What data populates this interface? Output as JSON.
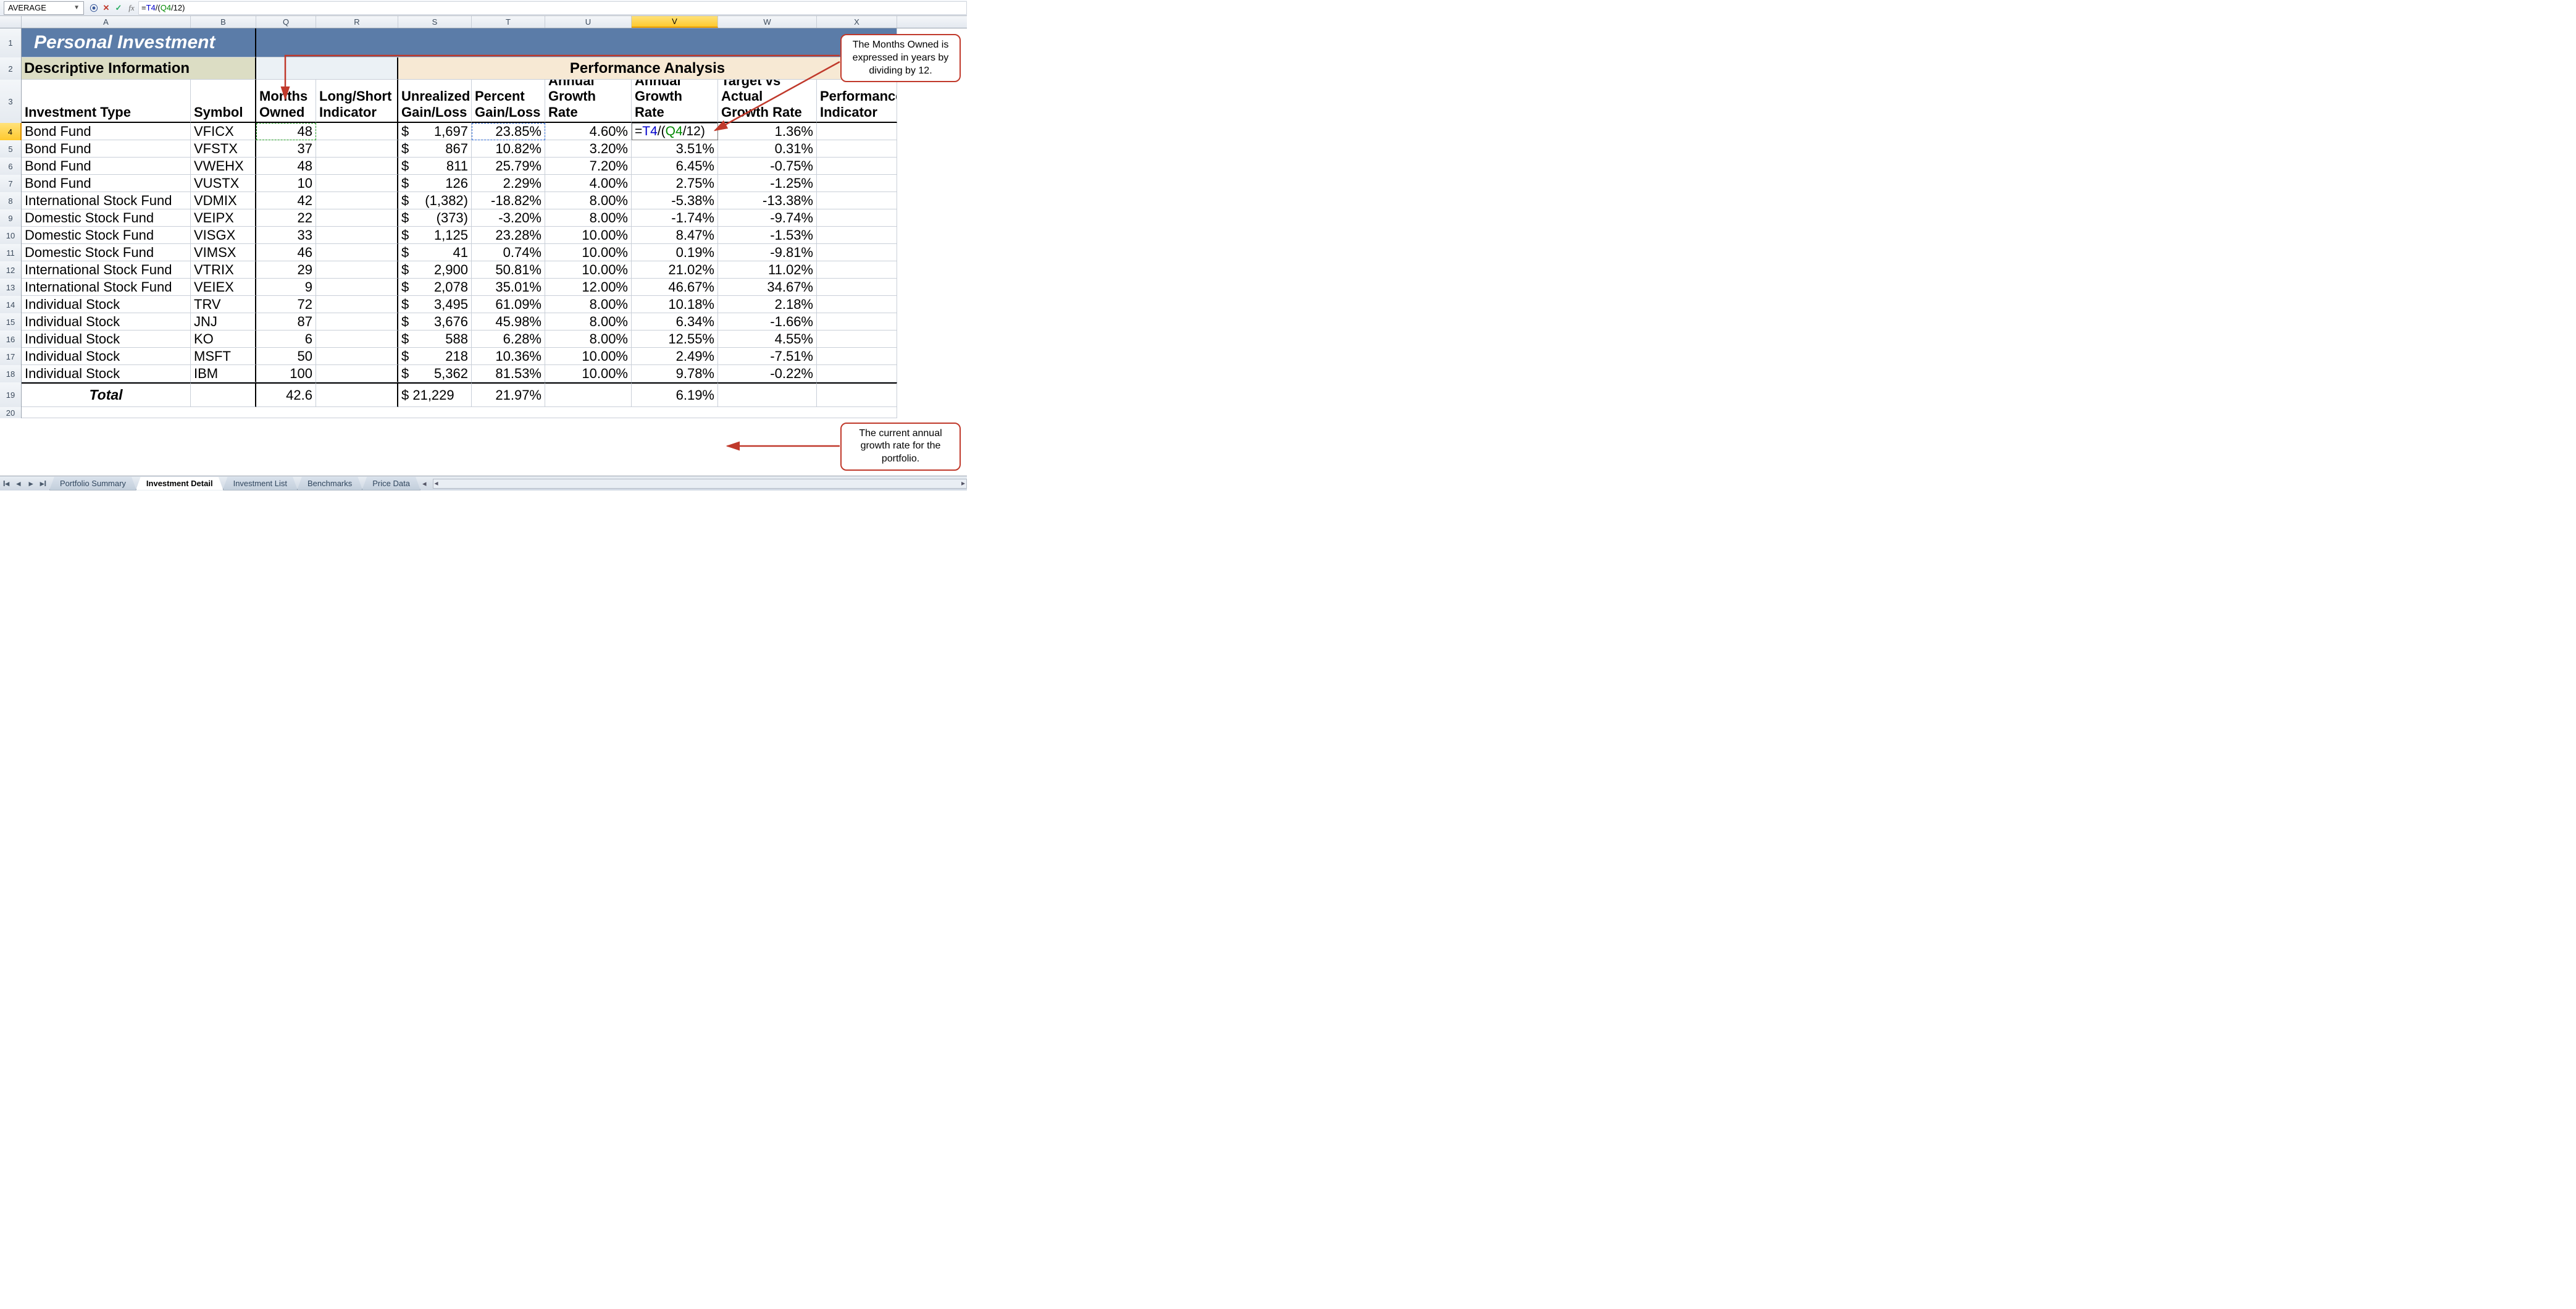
{
  "formula_bar": {
    "name_box": "AVERAGE",
    "formula_html": "=<span class='t'>T4</span>/(<span class='g'>Q4</span>/12)"
  },
  "columns": [
    {
      "l": "A",
      "w": "wA"
    },
    {
      "l": "B",
      "w": "wB"
    },
    {
      "l": "Q",
      "w": "wQ"
    },
    {
      "l": "R",
      "w": "wR"
    },
    {
      "l": "S",
      "w": "wS"
    },
    {
      "l": "T",
      "w": "wT"
    },
    {
      "l": "U",
      "w": "wU"
    },
    {
      "l": "V",
      "w": "wV",
      "sel": true
    },
    {
      "l": "W",
      "w": "wW"
    },
    {
      "l": "X",
      "w": "wX"
    }
  ],
  "title": "Personal Investment",
  "section_left": "Descriptive Information",
  "section_right": "Performance Analysis",
  "headers": {
    "a": "Investment Type",
    "b": "Symbol",
    "q": "Months Owned",
    "r": "Long/Short Indicator",
    "s": "Unrealized Gain/Loss",
    "t": "Percent Gain/Loss",
    "u": "Target Annual Growth Rate",
    "v": "Actual Annual Growth Rate",
    "w": "Target vs Actual Growth Rate",
    "x": "Performance Indicator"
  },
  "rows": [
    {
      "n": 4,
      "a": "Bond Fund",
      "b": "VFICX",
      "q": "48",
      "s": "1,697",
      "t": "23.85%",
      "u": "4.60%",
      "v_edit": "=<span class='t'>T4</span>/(<span class='g'>Q4</span>/12)",
      "w": "1.36%"
    },
    {
      "n": 5,
      "a": "Bond Fund",
      "b": "VFSTX",
      "q": "37",
      "s": "867",
      "t": "10.82%",
      "u": "3.20%",
      "v": "3.51%",
      "w": "0.31%"
    },
    {
      "n": 6,
      "a": "Bond Fund",
      "b": "VWEHX",
      "q": "48",
      "s": "811",
      "t": "25.79%",
      "u": "7.20%",
      "v": "6.45%",
      "w": "-0.75%"
    },
    {
      "n": 7,
      "a": "Bond Fund",
      "b": "VUSTX",
      "q": "10",
      "s": "126",
      "t": "2.29%",
      "u": "4.00%",
      "v": "2.75%",
      "w": "-1.25%"
    },
    {
      "n": 8,
      "a": "International Stock Fund",
      "b": "VDMIX",
      "q": "42",
      "s": "(1,382)",
      "neg": true,
      "t": "-18.82%",
      "u": "8.00%",
      "v": "-5.38%",
      "w": "-13.38%"
    },
    {
      "n": 9,
      "a": "Domestic Stock Fund",
      "b": "VEIPX",
      "q": "22",
      "s": "(373)",
      "neg": true,
      "t": "-3.20%",
      "u": "8.00%",
      "v": "-1.74%",
      "w": "-9.74%"
    },
    {
      "n": 10,
      "a": "Domestic Stock Fund",
      "b": "VISGX",
      "q": "33",
      "s": "1,125",
      "t": "23.28%",
      "u": "10.00%",
      "v": "8.47%",
      "w": "-1.53%"
    },
    {
      "n": 11,
      "a": "Domestic Stock Fund",
      "b": "VIMSX",
      "q": "46",
      "s": "41",
      "t": "0.74%",
      "u": "10.00%",
      "v": "0.19%",
      "w": "-9.81%"
    },
    {
      "n": 12,
      "a": "International Stock Fund",
      "b": "VTRIX",
      "q": "29",
      "s": "2,900",
      "t": "50.81%",
      "u": "10.00%",
      "v": "21.02%",
      "w": "11.02%"
    },
    {
      "n": 13,
      "a": "International Stock Fund",
      "b": "VEIEX",
      "q": "9",
      "s": "2,078",
      "t": "35.01%",
      "u": "12.00%",
      "v": "46.67%",
      "w": "34.67%"
    },
    {
      "n": 14,
      "a": "Individual Stock",
      "b": "TRV",
      "q": "72",
      "s": "3,495",
      "t": "61.09%",
      "u": "8.00%",
      "v": "10.18%",
      "w": "2.18%"
    },
    {
      "n": 15,
      "a": "Individual Stock",
      "b": "JNJ",
      "q": "87",
      "s": "3,676",
      "t": "45.98%",
      "u": "8.00%",
      "v": "6.34%",
      "w": "-1.66%"
    },
    {
      "n": 16,
      "a": "Individual Stock",
      "b": "KO",
      "q": "6",
      "s": "588",
      "t": "6.28%",
      "u": "8.00%",
      "v": "12.55%",
      "w": "4.55%"
    },
    {
      "n": 17,
      "a": "Individual Stock",
      "b": "MSFT",
      "q": "50",
      "s": "218",
      "t": "10.36%",
      "u": "10.00%",
      "v": "2.49%",
      "w": "-7.51%"
    },
    {
      "n": 18,
      "a": "Individual Stock",
      "b": "IBM",
      "q": "100",
      "s": "5,362",
      "t": "81.53%",
      "u": "10.00%",
      "v": "9.78%",
      "w": "-0.22%"
    }
  ],
  "total": {
    "label": "Total",
    "q": "42.6",
    "s": "$ 21,229",
    "t": "21.97%",
    "v": "6.19%"
  },
  "tabs": [
    "Portfolio Summary",
    "Investment Detail",
    "Investment List",
    "Benchmarks",
    "Price Data"
  ],
  "active_tab": 1,
  "callout1": "The Months Owned is expressed in years by dividing by 12.",
  "callout2": "The current annual growth rate for the portfolio."
}
